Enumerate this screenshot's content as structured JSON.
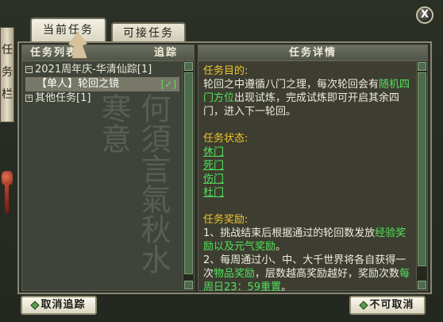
{
  "tabs": {
    "current": "当前任务",
    "available": "可接任务"
  },
  "close_label": "X",
  "deco_scroll_text": "任务栏",
  "left_panel": {
    "header_title": "任务列表",
    "header_track": "追踪",
    "tree": {
      "group1": "2021周年庆-华清仙踪[1]",
      "group1_toggle": "−",
      "child1": "【单人】轮回之镜",
      "child1_check": "[✓]",
      "group2": "其他任务[1]",
      "group2_toggle": "+"
    },
    "bg_calligraphy": "何須言氣秋水寒意"
  },
  "right_panel": {
    "header_title": "任务详情",
    "goal_heading": "任务目的:",
    "goal_text_1": "轮回之中遵循八门之理，每次轮回会有",
    "goal_text_green": "随机四门方位",
    "goal_text_2": "出现试炼，完成试炼即可开启其余四门，进入下一轮回。",
    "status_heading": "任务状态:",
    "status_links": [
      "休门",
      "死门",
      "伤门",
      "杜门"
    ],
    "reward_heading": "任务奖励:",
    "reward_1_text": "1、挑战结束后根据通过的轮回数发放",
    "reward_1_green": "经验奖励以及元气奖励",
    "reward_1_end": "。",
    "reward_2_text": "2、每周通过小、中、大千世界将各自获得一次",
    "reward_2_green": "物品奖励",
    "reward_2_mid": "，层数越高奖励越好，奖励次数",
    "reward_2_green2": "每周日23：59重置",
    "reward_2_end": "。"
  },
  "buttons": {
    "cancel_track": "取消追踪",
    "not_acceptable": "不可取消"
  },
  "colors": {
    "heading": "#f1c32c",
    "highlight": "#53e35b",
    "text": "#eeeede"
  }
}
